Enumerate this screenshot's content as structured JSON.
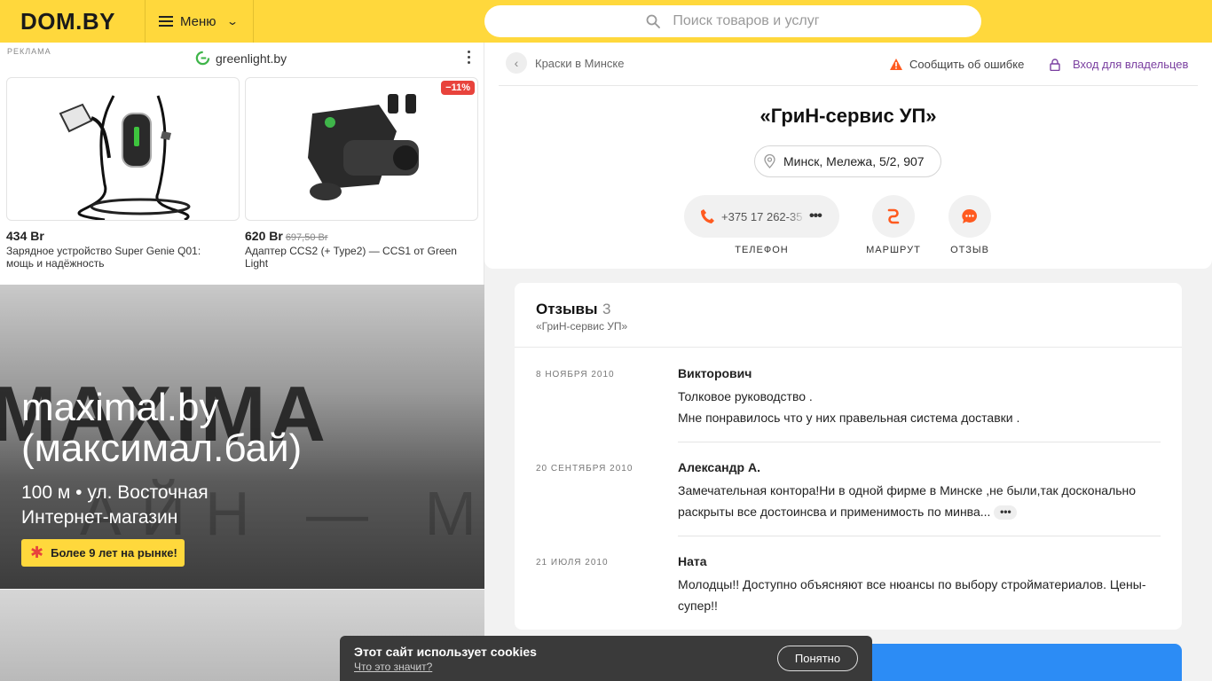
{
  "header": {
    "logo": "DOM.BY",
    "menu_label": "Меню",
    "search_placeholder": "Поиск товаров и услуг"
  },
  "ad": {
    "label": "РЕКЛАМА",
    "brand": "greenlight.by",
    "products": [
      {
        "price": "434 Br",
        "old_price": "",
        "discount": "",
        "title": "Зарядное устройство Super Genie Q01: мощь и надёжность"
      },
      {
        "price": "620 Br",
        "old_price": "697,50 Br",
        "discount": "−11%",
        "title": "Адаптер CCS2 (+ Type2) — CCS1 от Green Light"
      }
    ]
  },
  "promo": {
    "bg_word": "MAXIMA",
    "bg_word2": "АЙН — М",
    "title": "maximal.by (максимал.бай)",
    "line1": "100 м • ул. Восточная",
    "line2": "Интернет-магазин",
    "badge": "Более 9 лет на рынке!"
  },
  "company": {
    "breadcrumb": "Краски в Минске",
    "report_label": "Сообщить об ошибке",
    "owners_label": "Вход для владельцев",
    "name": "«ГриН-сервис УП»",
    "address": "Минск, Мележа, 5/2, 907",
    "phone_partial": "+375 17 262-35",
    "actions": {
      "phone": "ТЕЛЕФОН",
      "route": "МАРШРУТ",
      "review": "ОТЗЫВ"
    },
    "colors": {
      "accent": "#ff5a1f",
      "brand_yellow": "#ffd83c",
      "link_purple": "#7a3fa0"
    }
  },
  "reviews": {
    "title": "Отзывы",
    "count": "3",
    "subtitle": "«ГриН-сервис УП»",
    "items": [
      {
        "date": "8 НОЯБРЯ 2010",
        "author": "Викторович",
        "text": "Толковое руководство .\nМне понравилось что у них правельная система доставки ."
      },
      {
        "date": "20 СЕНТЯБРЯ 2010",
        "author": "Александр А.",
        "text": "Замечательная контора!Ни в одной фирме в Минске ,не были,так досконально раскрыты все достоинсва и применимость по минва..."
      },
      {
        "date": "21 ИЮЛЯ 2010",
        "author": "Ната",
        "text": "Молодцы!!  Доступно объясняют все нюансы по выбору стройматериалов. Цены-супер!!"
      }
    ]
  },
  "cookie": {
    "title": "Этот сайт использует cookies",
    "link": "Что это значит?",
    "button": "Понятно"
  }
}
